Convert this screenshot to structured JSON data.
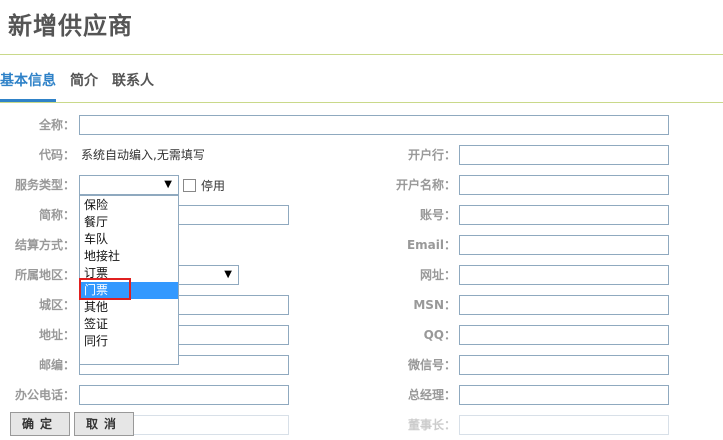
{
  "page": {
    "title": "新增供应商"
  },
  "tabs": [
    {
      "label": "基本信息"
    },
    {
      "label": "简介"
    },
    {
      "label": "联系人"
    }
  ],
  "left": {
    "full_name_label": "全称：",
    "code_label": "代码：",
    "code_value": "系统自动编入,无需填写",
    "service_type_label": "服务类型：",
    "service_type_value": "",
    "disable_label": "停用",
    "short_name_label": "简称：",
    "settlement_label": "结算方式：",
    "region_label": "所属地区：",
    "district_label": "城区：",
    "address_label": "地址：",
    "postcode_label": "邮编：",
    "phone_label": "办公电话："
  },
  "right": {
    "bank_label": "开户行：",
    "account_name_label": "开户名称：",
    "account_label": "账号：",
    "email_label": "Email：",
    "website_label": "网址：",
    "msn_label": "MSN：",
    "qq_label": "QQ：",
    "wechat_label": "微信号：",
    "gm_label": "总经理：",
    "chairman_label": "董事长："
  },
  "dropdown": {
    "options": [
      "保险",
      "餐厅",
      "车队",
      "地接社",
      "订票",
      "门票",
      "其他",
      "签证",
      "同行"
    ],
    "highlighted": "门票"
  },
  "buttons": {
    "ok": "确定",
    "cancel": "取消"
  },
  "colors": {
    "accent": "#2f82c8",
    "rule": "#c9d98a",
    "highlight": "#3399ff",
    "mark": "#e02020"
  }
}
